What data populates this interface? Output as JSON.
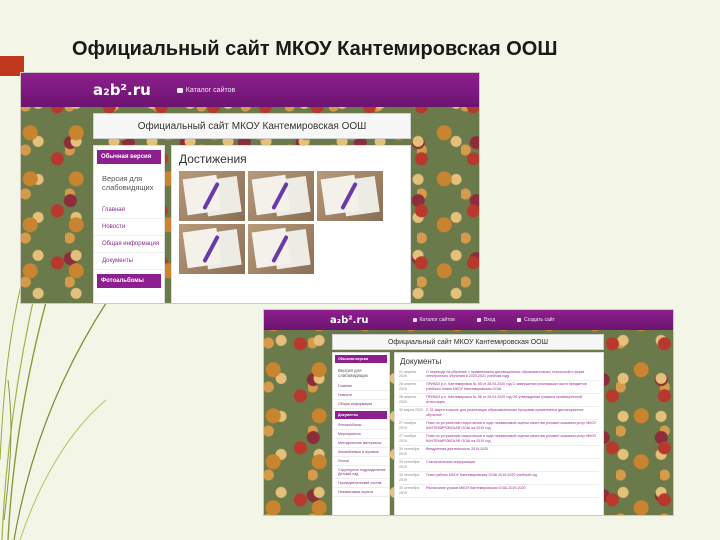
{
  "slide": {
    "title": "Официальный сайт МКОУ Кантемировская ООШ"
  },
  "site": {
    "logo": "a₂b².ru",
    "nav_catalog": "Каталог сайтов",
    "nav_login": "Вход",
    "nav_create": "Создать сайт",
    "header_title": "Официальный сайт МКОУ Кантемировская ООШ"
  },
  "screenshot_a": {
    "sidebar": {
      "active": "Обычная версия",
      "accessible": "Версия для слабовидящих",
      "items": [
        "Главная",
        "Новости",
        "Общая информация",
        "Документы"
      ],
      "active_bottom": "Фотоальбомы"
    },
    "page_title": "Достижения",
    "thumb_count_note": "5 photos"
  },
  "screenshot_b": {
    "sidebar": {
      "active": "Обычная версия",
      "accessible": "Версия для слабовидящих",
      "items_top": [
        "Главная",
        "Новости",
        "Общая информация"
      ],
      "active_mid": "Документы",
      "items_bottom": [
        "Фотоальбомы",
        "Мероприятия",
        "Методические материалы",
        "Ансамблевые и игровые",
        "Уголок",
        "Структурное подразделение Детский сад",
        "Пропедевтический состав",
        "Независимая оценка"
      ]
    },
    "page_title": "Документы",
    "documents": [
      {
        "date": "01 апреля 2020",
        "title": "О переходе на обучение с применением дистанционных образовательных технологий и форм электронного обучения в 2020-2021 учебном году"
      },
      {
        "date": "28 апреля 2020",
        "title": "ПРИКАЗ р.п. Кантемировка № 55 от 28.04.2020 год О завершении реализации части предметов учебного плана МКОУ Кантемировская ООШ"
      },
      {
        "date": "28 апреля 2020",
        "title": "ПРИКАЗ р.п. Кантемировка № 56 от 28.04.2020 год Об утверждении графика промежуточной аттестации"
      },
      {
        "date": "30 марта 2020",
        "title": "С 31 марта в школе для реализации образовательных программ применяется дистанционное обучение"
      },
      {
        "date": "27 ноября 2019",
        "title": "План по устранению недостатков в ходе независимой оценки качества условий оказания услуг МКОУ КАНТЕМИРОВСКАЯ ООШ на 2019 год"
      },
      {
        "date": "27 ноября 2019",
        "title": "План по устранению недостатков в ходе независимой оценки качества условий оказания услуг МКОУ КАНТЕМИРОВСКАЯ ООШ на 2019 год"
      },
      {
        "date": "30 сентября 2019",
        "title": "Внедренная деятельность 2019-2020"
      },
      {
        "date": "30 сентября 2019",
        "title": "Статистическая информация"
      },
      {
        "date": "30 сентября 2019",
        "title": "План работы МКОУ Кантемировская ООШ 2019-2020 учебный год"
      },
      {
        "date": "30 сентября 2019",
        "title": "Расписание уроков МКОУ Кантемировская ООШ 2019-2020"
      }
    ]
  },
  "colors": {
    "brand_purple": "#8e1f8e",
    "accent_red": "#c0391f",
    "grass_green": "#8a9a3a"
  }
}
